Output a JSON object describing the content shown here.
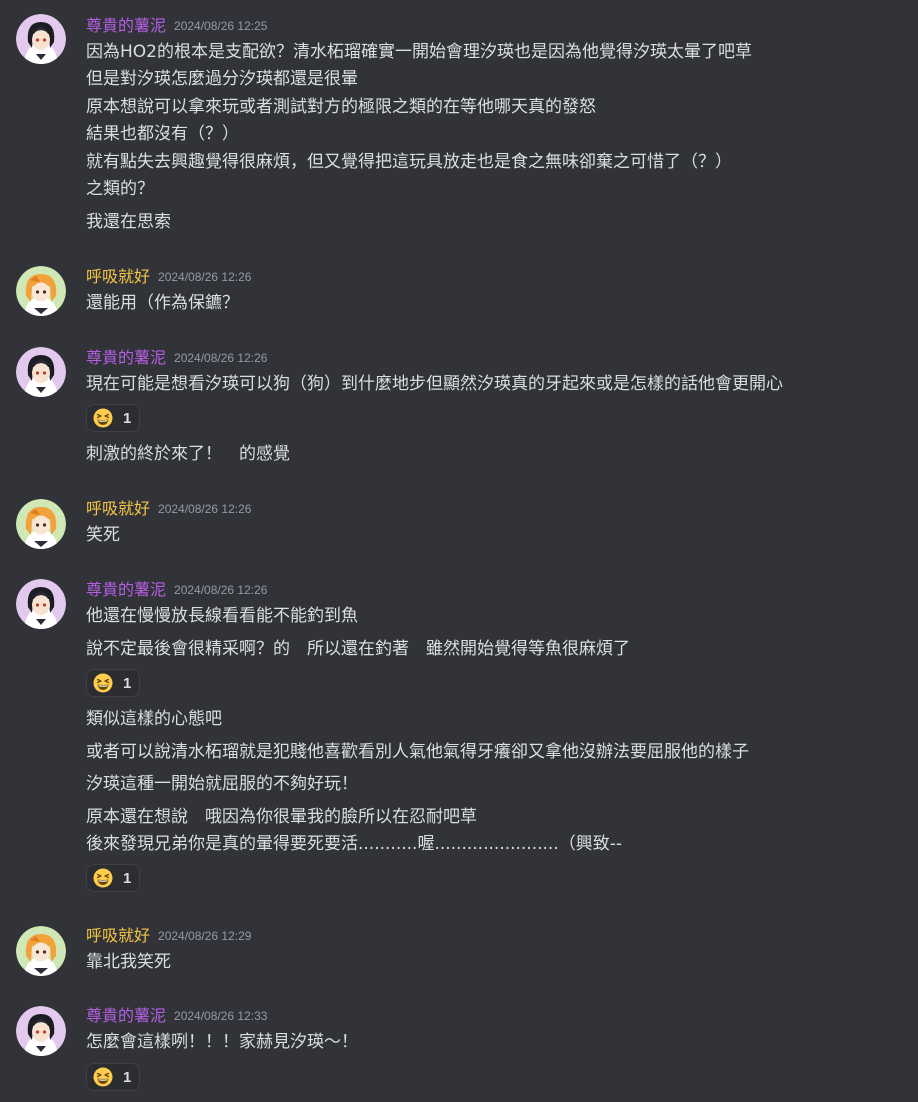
{
  "colors": {
    "background": "#313338",
    "text": "#dbdee1",
    "timestamp": "#949ba4",
    "user_purple": "#b45ee3",
    "user_yellow": "#f5c542",
    "reaction_bg": "#2b2d31"
  },
  "messages": [
    {
      "user": "尊貴的薯泥",
      "timestamp": "2024/08/26 12:25",
      "avatar_icon": "anime-girl-purple-avatar",
      "lines": [
        "因為HO2的根本是支配欲？清水柘瑠確實一開始會理汐瑛也是因為他覺得汐瑛太暈了吧草",
        "但是對汐瑛怎麼過分汐瑛都還是很暈",
        "原本想說可以拿來玩或者測試對方的極限之類的在等他哪天真的發怒",
        "結果也都沒有（？）",
        "就有點失去興趣覺得很麻煩，但又覺得把這玩具放走也是食之無味卻棄之可惜了（？）",
        "之類的？",
        "我還在思索"
      ]
    },
    {
      "user": "呼吸就好",
      "timestamp": "2024/08/26 12:26",
      "avatar_icon": "anime-girl-green-avatar",
      "lines": [
        "還能用（作為保鑣？"
      ]
    },
    {
      "user": "尊貴的薯泥",
      "timestamp": "2024/08/26 12:26",
      "avatar_icon": "anime-girl-purple-avatar",
      "lines": [
        "現在可能是想看汐瑛可以狗（狗）到什麼地步但顯然汐瑛真的牙起來或是怎樣的話他會更開心",
        "刺激的終於來了！　的感覺"
      ],
      "reactions": [
        {
          "emoji": "grinning-squint-emoji",
          "count": "1"
        }
      ]
    },
    {
      "user": "呼吸就好",
      "timestamp": "2024/08/26 12:26",
      "avatar_icon": "anime-girl-green-avatar",
      "lines": [
        "笑死"
      ]
    },
    {
      "user": "尊貴的薯泥",
      "timestamp": "2024/08/26 12:26",
      "avatar_icon": "anime-girl-purple-avatar",
      "lines": [
        "他還在慢慢放長線看看能不能釣到魚",
        "說不定最後會很精采啊？的　所以還在釣著　雖然開始覺得等魚很麻煩了",
        "類似這樣的心態吧",
        "或者可以說清水柘瑠就是犯賤他喜歡看別人氣他氣得牙癢卻又拿他沒辦法要屈服他的樣子",
        "汐瑛這種一開始就屈服的不夠好玩！",
        "原本還在想說　哦因為你很暈我的臉所以在忍耐吧草",
        "後來發現兄弟你是真的暈得要死要活...........喔.......................（興致--"
      ],
      "reactions": [
        {
          "emoji": "grinning-squint-emoji",
          "count": "1"
        },
        {
          "emoji": "grinning-squint-emoji",
          "count": "1"
        }
      ]
    },
    {
      "user": "呼吸就好",
      "timestamp": "2024/08/26 12:29",
      "avatar_icon": "anime-girl-green-avatar",
      "lines": [
        "靠北我笑死"
      ]
    },
    {
      "user": "尊貴的薯泥",
      "timestamp": "2024/08/26 12:33",
      "avatar_icon": "anime-girl-purple-avatar",
      "lines": [
        "怎麼會這樣咧！！！家赫見汐瑛～！"
      ],
      "reactions": [
        {
          "emoji": "grinning-squint-emoji",
          "count": "1"
        }
      ]
    }
  ]
}
